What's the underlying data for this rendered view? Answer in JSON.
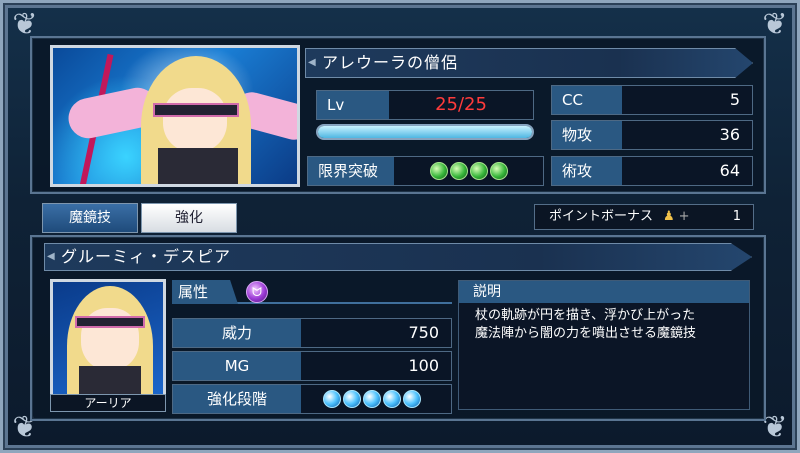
{
  "character": {
    "name": "アレウーラの僧侶",
    "level_label": "Lv",
    "level_value": "25/25",
    "exp_bar_fill_pct": 100,
    "limit_break_label": "限界突破",
    "limit_break_gems": 4,
    "stats": [
      {
        "label": "CC",
        "value": "5"
      },
      {
        "label": "物攻",
        "value": "36"
      },
      {
        "label": "術攻",
        "value": "64"
      }
    ]
  },
  "tabs": [
    {
      "label": "魔鏡技",
      "active": true
    },
    {
      "label": "強化",
      "active": false
    }
  ],
  "point_bonus": {
    "label": "ポイントボーナス",
    "icon": "person-bonus-icon",
    "plus": "+",
    "value": "1"
  },
  "skill": {
    "name": "グルーミィ・デスピア",
    "attribute_label": "属性",
    "attribute_icon": "dark-element-icon",
    "rows": [
      {
        "label": "威力",
        "value": "750"
      },
      {
        "label": "MG",
        "value": "100"
      }
    ],
    "enhance_label": "強化段階",
    "enhance_gems": 5,
    "description_title": "説明",
    "description_lines": [
      "杖の軌跡が円を描き、浮かび上がった",
      "魔法陣から闇の力を噴出させる魔鏡技"
    ],
    "character_name": "アーリア"
  },
  "colors": {
    "level_value": "#ff3b3b",
    "label_bg": "#2a5882",
    "value_bg": "#0a1526"
  }
}
